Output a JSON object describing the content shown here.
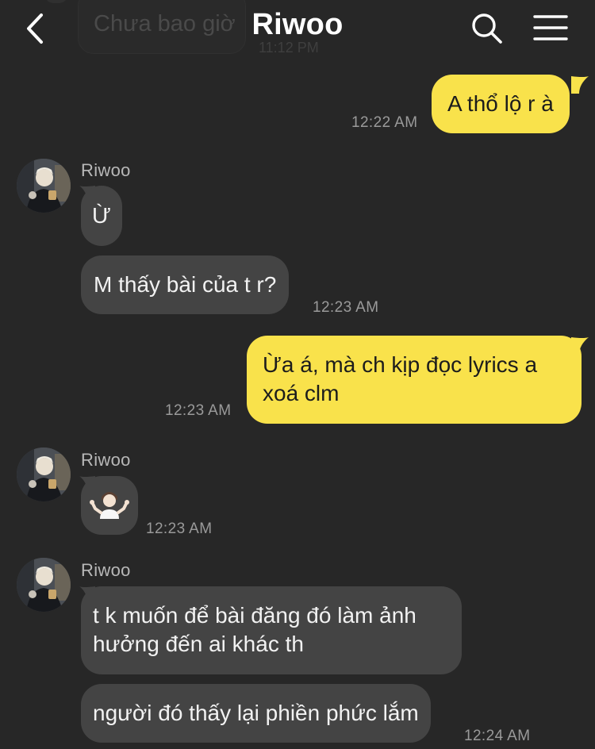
{
  "header": {
    "title": "Riwoo",
    "back_icon": "chevron-left-icon",
    "search_icon": "search-icon",
    "menu_icon": "hamburger-menu-icon"
  },
  "ghost": {
    "text": "Chưa bao giờ",
    "time": "11:12 PM"
  },
  "colors": {
    "background": "#272727",
    "incoming": "#444444",
    "outgoing": "#f9e24b"
  },
  "messages": [
    {
      "id": "m1",
      "direction": "out",
      "text": "A thổ lộ r à",
      "time": "12:22 AM"
    },
    {
      "id": "m2",
      "direction": "in",
      "sender": "Riwoo",
      "text": "Ừ"
    },
    {
      "id": "m3",
      "direction": "in",
      "text": "M thấy bài của t r?",
      "time": "12:23 AM"
    },
    {
      "id": "m4",
      "direction": "out",
      "line1": "Ừa á, mà ch kịp đọc lyrics a",
      "line2": "xoá clm",
      "time": "12:23 AM"
    },
    {
      "id": "m5",
      "direction": "in",
      "sender": "Riwoo",
      "emoji": "🤷🏻‍♂️",
      "emoji_name": "man-shrugging-emoji",
      "time": "12:23 AM"
    },
    {
      "id": "m6",
      "direction": "in",
      "sender": "Riwoo",
      "line1": "t k muốn để bài đăng đó làm ảnh",
      "line2": "hưởng đến ai khác th"
    },
    {
      "id": "m7",
      "direction": "in",
      "text": "người đó thấy lại phiền phức lắm",
      "time": "12:24 AM"
    }
  ]
}
